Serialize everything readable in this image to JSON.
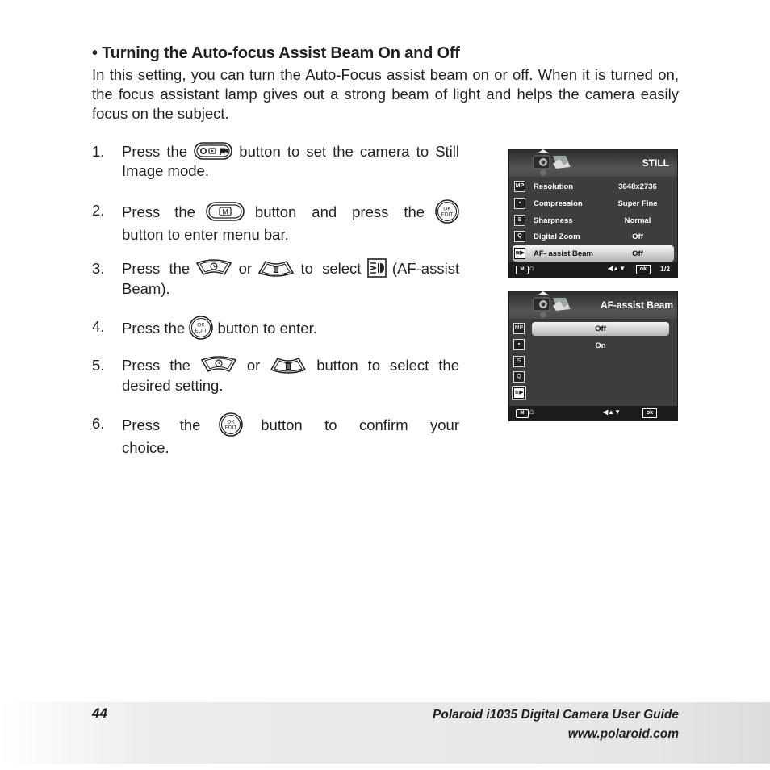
{
  "section": {
    "heading": "• Turning the Auto-focus Assist Beam On and Off",
    "intro": "In this setting, you can turn the Auto-Focus assist beam on or off. When it is turned on, the focus assistant lamp gives out a strong beam of light and helps the camera easily focus on the subject."
  },
  "steps": [
    {
      "num": "1.",
      "a": "Press the",
      "icon1": "mode-button-icon",
      "b": "button to set the camera to Still Image mode."
    },
    {
      "num": "2.",
      "a": "Press the",
      "icon1": "menu-button-icon",
      "b": "button and press the",
      "icon2": "ok-edit-button-icon",
      "c": "button to enter menu bar."
    },
    {
      "num": "3.",
      "a": "Press the",
      "icon1": "up-timer-button-icon",
      "b": "or",
      "icon2": "down-delete-button-icon",
      "c": "to select",
      "icon3": "af-assist-beam-icon",
      "d": "(AF-assist Beam)."
    },
    {
      "num": "4.",
      "a": "Press the",
      "icon1": "ok-edit-button-icon",
      "b": "button to enter."
    },
    {
      "num": "5.",
      "a": "Press the",
      "icon1": "up-timer-button-icon",
      "b": "or",
      "icon2": "down-delete-button-icon",
      "c": "button to select the desired setting."
    },
    {
      "num": "6.",
      "a": "Press the",
      "icon1": "ok-edit-button-icon",
      "b": "button to confirm your choice."
    }
  ],
  "button_glyphs": {
    "menu": "M",
    "ok": "OK",
    "edit": "EDIT"
  },
  "screen1": {
    "title": "STILL",
    "rows": [
      {
        "icon": "MP",
        "label": "Resolution",
        "value": "3648x2736",
        "selected": false
      },
      {
        "icon": "▪",
        "label": "Compression",
        "value": "Super Fine",
        "selected": false
      },
      {
        "icon": "S",
        "label": "Sharpness",
        "value": "Normal",
        "selected": false
      },
      {
        "icon": "Q",
        "label": "Digital Zoom",
        "value": "Off",
        "selected": false
      },
      {
        "icon": "≣▶",
        "label": "AF- assist Beam",
        "value": "Off",
        "selected": true
      }
    ],
    "bottom": {
      "menu": "M",
      "home": "⌂",
      "nav": "◀▲▼",
      "ok": "ok",
      "page": "1/2"
    }
  },
  "screen2": {
    "title": "AF-assist Beam",
    "side_icons": [
      {
        "icon": "MP",
        "selected": false
      },
      {
        "icon": "▪",
        "selected": false
      },
      {
        "icon": "S",
        "selected": false
      },
      {
        "icon": "Q",
        "selected": false
      },
      {
        "icon": "≣▶",
        "selected": true
      }
    ],
    "options": [
      {
        "label": "Off",
        "selected": true
      },
      {
        "label": "On",
        "selected": false
      }
    ],
    "bottom": {
      "menu": "M",
      "home": "⌂",
      "nav": "◀▲▼",
      "ok": "ok"
    }
  },
  "footer": {
    "page_number": "44",
    "guide_title": "Polaroid i1035 Digital Camera User Guide",
    "url": "www.polaroid.com"
  }
}
